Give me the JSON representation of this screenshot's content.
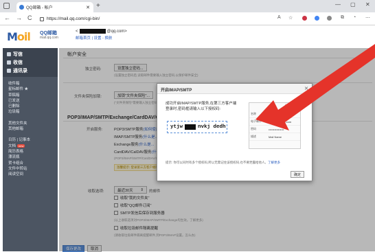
{
  "browser": {
    "tab_title": "QQ邮箱 - 帐户",
    "url": "https://mail.qq.com/cgi-bin/",
    "new_tab": "+",
    "back": "←",
    "forward": "→",
    "reload": "C",
    "read_aloud": "A",
    "zoom": "☆",
    "minimize": "—",
    "maximize": "▢",
    "close": "✕"
  },
  "header": {
    "logo_text": "M",
    "logo_rest": "oil",
    "brand": "QQ邮箱",
    "brand_domain": "mail.qq.com",
    "user_suffix": "@qq.com>",
    "user_prefix": "<",
    "links": "邮箱首页 | 设置 - 换肤"
  },
  "sidebar": {
    "primary": [
      "写信",
      "收信",
      "通讯录"
    ],
    "items": [
      "收件箱",
      "星标邮件 ★",
      "草稿箱",
      "已发送",
      "已删除",
      "垃圾箱"
    ],
    "items2": [
      "其他文件夹",
      "其他邮箱"
    ],
    "items3": [
      "日历 | 记事本",
      "文档",
      "简历表格",
      "漂流瓶",
      "贺卡组合",
      "文件中转站",
      "阅读空间"
    ],
    "badge": "new"
  },
  "main": {
    "account_title": "帐户安全",
    "independent_password_label": "独立密码:",
    "independent_password_btn": "设置独立密码...",
    "independent_password_hint": "(设置独立密码后,读取邮件需要输入独立密码,以保护邮件安全)",
    "wechat_label": "文件夹保险加锁:",
    "wechat_btn": "加锁\"文件夹保险\"...",
    "wechat_hint": "(\"文件夹保险\"需要输入独立密码)",
    "big_title": "POP3/IMAP/SMTP/Exchange/CardDAV/CalDAV服务",
    "services_label": "开启服务:",
    "services": [
      {
        "name": "POP3/SMTP服务",
        "link": "(如何使用..."
      },
      {
        "name": "IMAP/SMTP服务",
        "link": "(什么是..."
      },
      {
        "name": "Exchange服务",
        "link": "(什么是..."
      },
      {
        "name": "CardDAV/CalDAV服务",
        "link": "(什么是..."
      }
    ],
    "opened": "已开启",
    "services_hint": "(POP3/IMAP/SMTP/CardDAV/CalDAV服务均支持SSL连接...)",
    "warn_text": "温馨提示: 登录第三方客户端时...",
    "receive_label": "收取选项:",
    "receive_select": "最近30天",
    "receive_suffix": "的邮件",
    "checks": [
      "收取\"我的文件夹\"",
      "收取\"QQ邮件订阅\"",
      "SMTP发信后保存到服务器",
      "收取垃圾邮件隔离提醒"
    ],
    "check_hint1": "(以上收取选项对POP3/IMAP/SMTP/Exchange均生效。了解更多)",
    "check_hint2": "(请收取垃圾邮件隔离提醒邮件,到POP3/IMAP设置。怎么办)",
    "save": "保存更改",
    "cancel": "取消"
  },
  "dialog": {
    "title": "开启IMAP/SMTP",
    "close": "✕",
    "message": "成功开启IMAP/SMTP服务,在第三方客户端登录时,密码框请输入以下授权码:",
    "code_left": "ytjw",
    "code_right": "nvkj dedh",
    "card_caption": "例: Foxmail",
    "card_rows": [
      {
        "k": "名称",
        "v": "Mail Name"
      },
      {
        "k": "电子邮件",
        "v": "mailbase@qq.com"
      },
      {
        "k": "密码",
        "v": "••••••••••••••••"
      },
      {
        "k": "描述",
        "v": "Mail Name"
      }
    ],
    "note": "提示: 你可以同时有多个授权码,所以无需记住该授权码,也不要泄露给他人。",
    "note_link": "了解更多",
    "ok": "确定"
  },
  "colors": {
    "arrow": "#e5332a",
    "sidebar": "#4c5562",
    "link": "#2a5dbf"
  }
}
